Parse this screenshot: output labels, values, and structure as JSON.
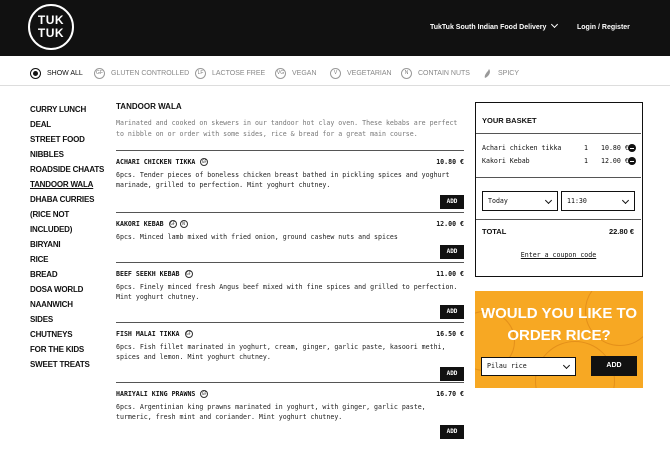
{
  "header": {
    "logo_line1": "TUK",
    "logo_line2": "TUK",
    "location": "TukTuk South Indian Food Delivery",
    "login": "Login / Register"
  },
  "filters": [
    {
      "label": "SHOW ALL",
      "icon": "radio-selected-icon",
      "abbr": ""
    },
    {
      "label": "GLUTEN CONTROLLED",
      "icon": "gluten-icon",
      "abbr": "GF"
    },
    {
      "label": "LACTOSE FREE",
      "icon": "lactose-icon",
      "abbr": "LF"
    },
    {
      "label": "VEGAN",
      "icon": "vegan-icon",
      "abbr": "VG"
    },
    {
      "label": "VEGETARIAN",
      "icon": "vegetarian-icon",
      "abbr": "V"
    },
    {
      "label": "CONTAIN NUTS",
      "icon": "nuts-icon",
      "abbr": "N"
    },
    {
      "label": "SPICY",
      "icon": "chili-icon",
      "abbr": ""
    }
  ],
  "categories": [
    "CURRY LUNCH DEAL",
    "STREET FOOD NIBBLES",
    "ROADSIDE CHAATS",
    "TANDOOR WALA",
    "DHABA CURRIES (RICE NOT INCLUDED)",
    "BIRYANI",
    "RICE",
    "BREAD",
    "DOSA WORLD",
    "NAANWICH",
    "SIDES",
    "CHUTNEYS",
    "FOR THE KIDS",
    "SWEET TREATS"
  ],
  "section": {
    "title": "TANDOOR WALA",
    "description": "Marinated and cooked on skewers in our tandoor hot clay oven. These kebabs are perfect to nibble on or order with some sides, rice & bread for a great main course."
  },
  "items": [
    {
      "name": "ACHARI CHICKEN TIKKA",
      "badges": [
        "GF"
      ],
      "price": "10.80 €",
      "description": "6pcs. Tender pieces of boneless chicken breast bathed in pickling spices and yoghurt marinade, grilled to perfection. Mint yoghurt chutney.",
      "add": "ADD"
    },
    {
      "name": "KAKORI KEBAB",
      "badges": [
        "GF",
        "N"
      ],
      "price": "12.00 €",
      "description": "6pcs. Minced lamb mixed with fried onion, ground cashew nuts and spices",
      "add": "ADD"
    },
    {
      "name": "BEEF SEEKH KEBAB",
      "badges": [
        "GF"
      ],
      "price": "11.00 €",
      "description": "6pcs. Finely minced fresh Angus beef mixed with fine spices and grilled to perfection. Mint yoghurt chutney.",
      "add": "ADD"
    },
    {
      "name": "FISH MALAI TIKKA",
      "badges": [
        "GF"
      ],
      "price": "16.50 €",
      "description": "6pcs. Fish fillet marinated in yoghurt, cream, ginger, garlic paste, kasoori methi, spices and lemon. Mint yoghurt chutney.",
      "add": "ADD"
    },
    {
      "name": "HARIYALI KING PRAWNS",
      "badges": [
        "GF"
      ],
      "price": "16.70 €",
      "description": "6pcs. Argentinian king prawns marinated in yoghurt, with ginger, garlic paste, turmeric, fresh mint and coriander. Mint yoghurt chutney.",
      "add": "ADD"
    }
  ],
  "basket": {
    "title": "YOUR BASKET",
    "lines": [
      {
        "name": "Achari chicken tikka",
        "qty": "1",
        "price": "10.80 €"
      },
      {
        "name": "Kakori Kebab",
        "qty": "1",
        "price": "12.00 €"
      }
    ],
    "day": "Today",
    "time": "11:30",
    "total_label": "TOTAL",
    "total_value": "22.80 €",
    "coupon": "Enter a coupon code"
  },
  "rice_promo": {
    "line1": "WOULD YOU LIKE TO",
    "line2": "ORDER RICE?",
    "select_value": "Pilau rice",
    "add": "ADD"
  }
}
